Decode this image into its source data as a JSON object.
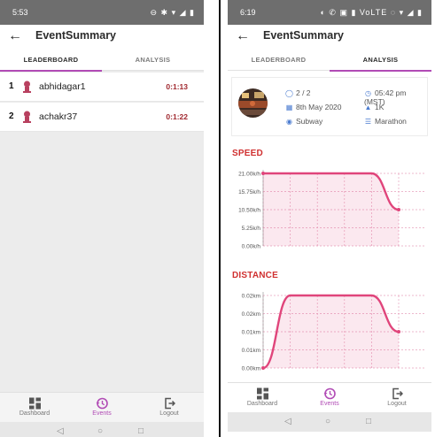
{
  "left": {
    "status": {
      "time": "5:53",
      "icons": "⊖ ✱ ▾ ◢ ▮"
    },
    "appbar": {
      "title": "EventSummary"
    },
    "tabs": {
      "leaderboard": "LEADERBOARD",
      "analysis": "ANALYSIS",
      "active": "leaderboard"
    },
    "leaderboard": [
      {
        "rank": "1",
        "name": "abhidagar1",
        "time": "0:1:13"
      },
      {
        "rank": "2",
        "name": "achakr37",
        "time": "0:1:22"
      }
    ],
    "nav": [
      {
        "label": "Dashboard",
        "icon": "dashboard-icon"
      },
      {
        "label": "Events",
        "icon": "history-icon"
      },
      {
        "label": "Logout",
        "icon": "logout-icon"
      }
    ],
    "accent": "#b14bb5"
  },
  "right": {
    "status": {
      "time": "6:19",
      "icons": "◐ ✆ ▣ ▮  VoLTE ◌ ▾ ◢ ▮"
    },
    "appbar": {
      "title": "EventSummary"
    },
    "tabs": {
      "leaderboard": "LEADERBOARD",
      "analysis": "ANALYSIS",
      "active": "analysis"
    },
    "summary": {
      "participants": "2 / 2",
      "date": "8th May 2020",
      "location": "Subway",
      "time": "05:42 pm (MST)",
      "distance": "1K",
      "type": "Marathon"
    },
    "speed_title": "SPEED",
    "distance_title": "DISTANCE",
    "nav": [
      {
        "label": "Dashboard",
        "icon": "dashboard-icon"
      },
      {
        "label": "Events",
        "icon": "history-icon"
      },
      {
        "label": "Logout",
        "icon": "logout-icon"
      }
    ]
  },
  "chart_data": [
    {
      "type": "area",
      "title": "SPEED",
      "ylabels": [
        "21.00k/h",
        "15.75k/h",
        "10.50k/h",
        "5.25k/h",
        "0.00k/h"
      ],
      "ylim": [
        0,
        21
      ],
      "x": [
        0,
        1,
        2,
        3,
        4,
        5
      ],
      "values": [
        21,
        21,
        21,
        21,
        21,
        10.5
      ],
      "color": "#e0457b"
    },
    {
      "type": "area",
      "title": "DISTANCE",
      "ylabels": [
        "0.02km",
        "0.02km",
        "0.01km",
        "0.01km",
        "0.00km"
      ],
      "ylim": [
        0,
        0.02
      ],
      "x": [
        0,
        1,
        2,
        3,
        4,
        5
      ],
      "values": [
        0,
        0.02,
        0.02,
        0.02,
        0.02,
        0.01
      ],
      "color": "#e0457b"
    }
  ]
}
